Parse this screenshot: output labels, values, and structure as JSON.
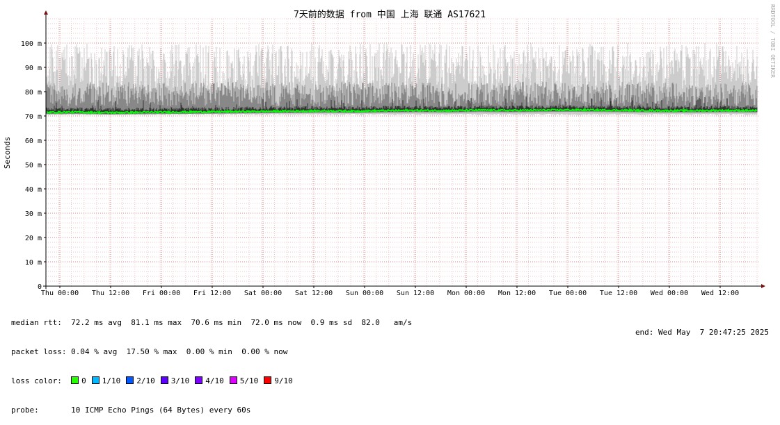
{
  "chart_data": {
    "type": "area",
    "title": "7天前的数据 from 中国 上海 联通 AS17621",
    "ylabel": "Seconds",
    "ylim": [
      0,
      0.11
    ],
    "yticks": [
      {
        "value": 0,
        "label": "0"
      },
      {
        "value": 0.01,
        "label": "10 m"
      },
      {
        "value": 0.02,
        "label": "20 m"
      },
      {
        "value": 0.03,
        "label": "30 m"
      },
      {
        "value": 0.04,
        "label": "40 m"
      },
      {
        "value": 0.05,
        "label": "50 m"
      },
      {
        "value": 0.06,
        "label": "60 m"
      },
      {
        "value": 0.07,
        "label": "70 m"
      },
      {
        "value": 0.08,
        "label": "80 m"
      },
      {
        "value": 0.09,
        "label": "90 m"
      },
      {
        "value": 0.1,
        "label": "100 m"
      }
    ],
    "xticks": [
      "Thu 00:00",
      "Thu 12:00",
      "Fri 00:00",
      "Fri 12:00",
      "Sat 00:00",
      "Sat 12:00",
      "Sun 00:00",
      "Sun 12:00",
      "Mon 00:00",
      "Mon 12:00",
      "Tue 00:00",
      "Tue 12:00",
      "Wed 00:00",
      "Wed 12:00"
    ],
    "grid": true,
    "watermark": "RRDTOOL / TOBI OETIKER",
    "series": [
      {
        "name": "median rtt",
        "color": "#00ff00",
        "values_ms": [
          71.5,
          71.6,
          71.4,
          71.5,
          71.6,
          71.7,
          71.8,
          71.9,
          72.0,
          72.1,
          72.0,
          72.2,
          72.3,
          72.2,
          72.4,
          72.3,
          72.4,
          72.5,
          72.4,
          72.3,
          72.2,
          72.2,
          72.3,
          72.2
        ]
      },
      {
        "name": "smoke",
        "color": "#bbbbbb",
        "min_ms": 70.6,
        "max_ms": 100
      }
    ]
  },
  "stats": {
    "median": {
      "label": "median rtt:",
      "avg": "72.2 ms avg",
      "max": "81.1 ms max",
      "min": "70.6 ms min",
      "now": "72.0 ms now",
      "sd": "0.9 ms sd",
      "amps": "82.0   am/s"
    },
    "loss": {
      "label": "packet loss:",
      "avg": "0.04 % avg",
      "max": "17.50 % max",
      "min": "0.00 % min",
      "now": "0.00 % now"
    },
    "loss_color": {
      "label": "loss color:",
      "items": [
        {
          "label": "0",
          "color": "#26ff00"
        },
        {
          "label": "1/10",
          "color": "#00b8ff"
        },
        {
          "label": "2/10",
          "color": "#0059ff"
        },
        {
          "label": "3/10",
          "color": "#5e00ff"
        },
        {
          "label": "4/10",
          "color": "#7e00ff"
        },
        {
          "label": "5/10",
          "color": "#dd00ff"
        },
        {
          "label": "9/10",
          "color": "#ff0000"
        }
      ]
    },
    "probe": {
      "label": "probe:",
      "value": "10 ICMP Echo Pings (64 Bytes) every 60s"
    },
    "end": "end: Wed May  7 20:47:25 2025"
  }
}
